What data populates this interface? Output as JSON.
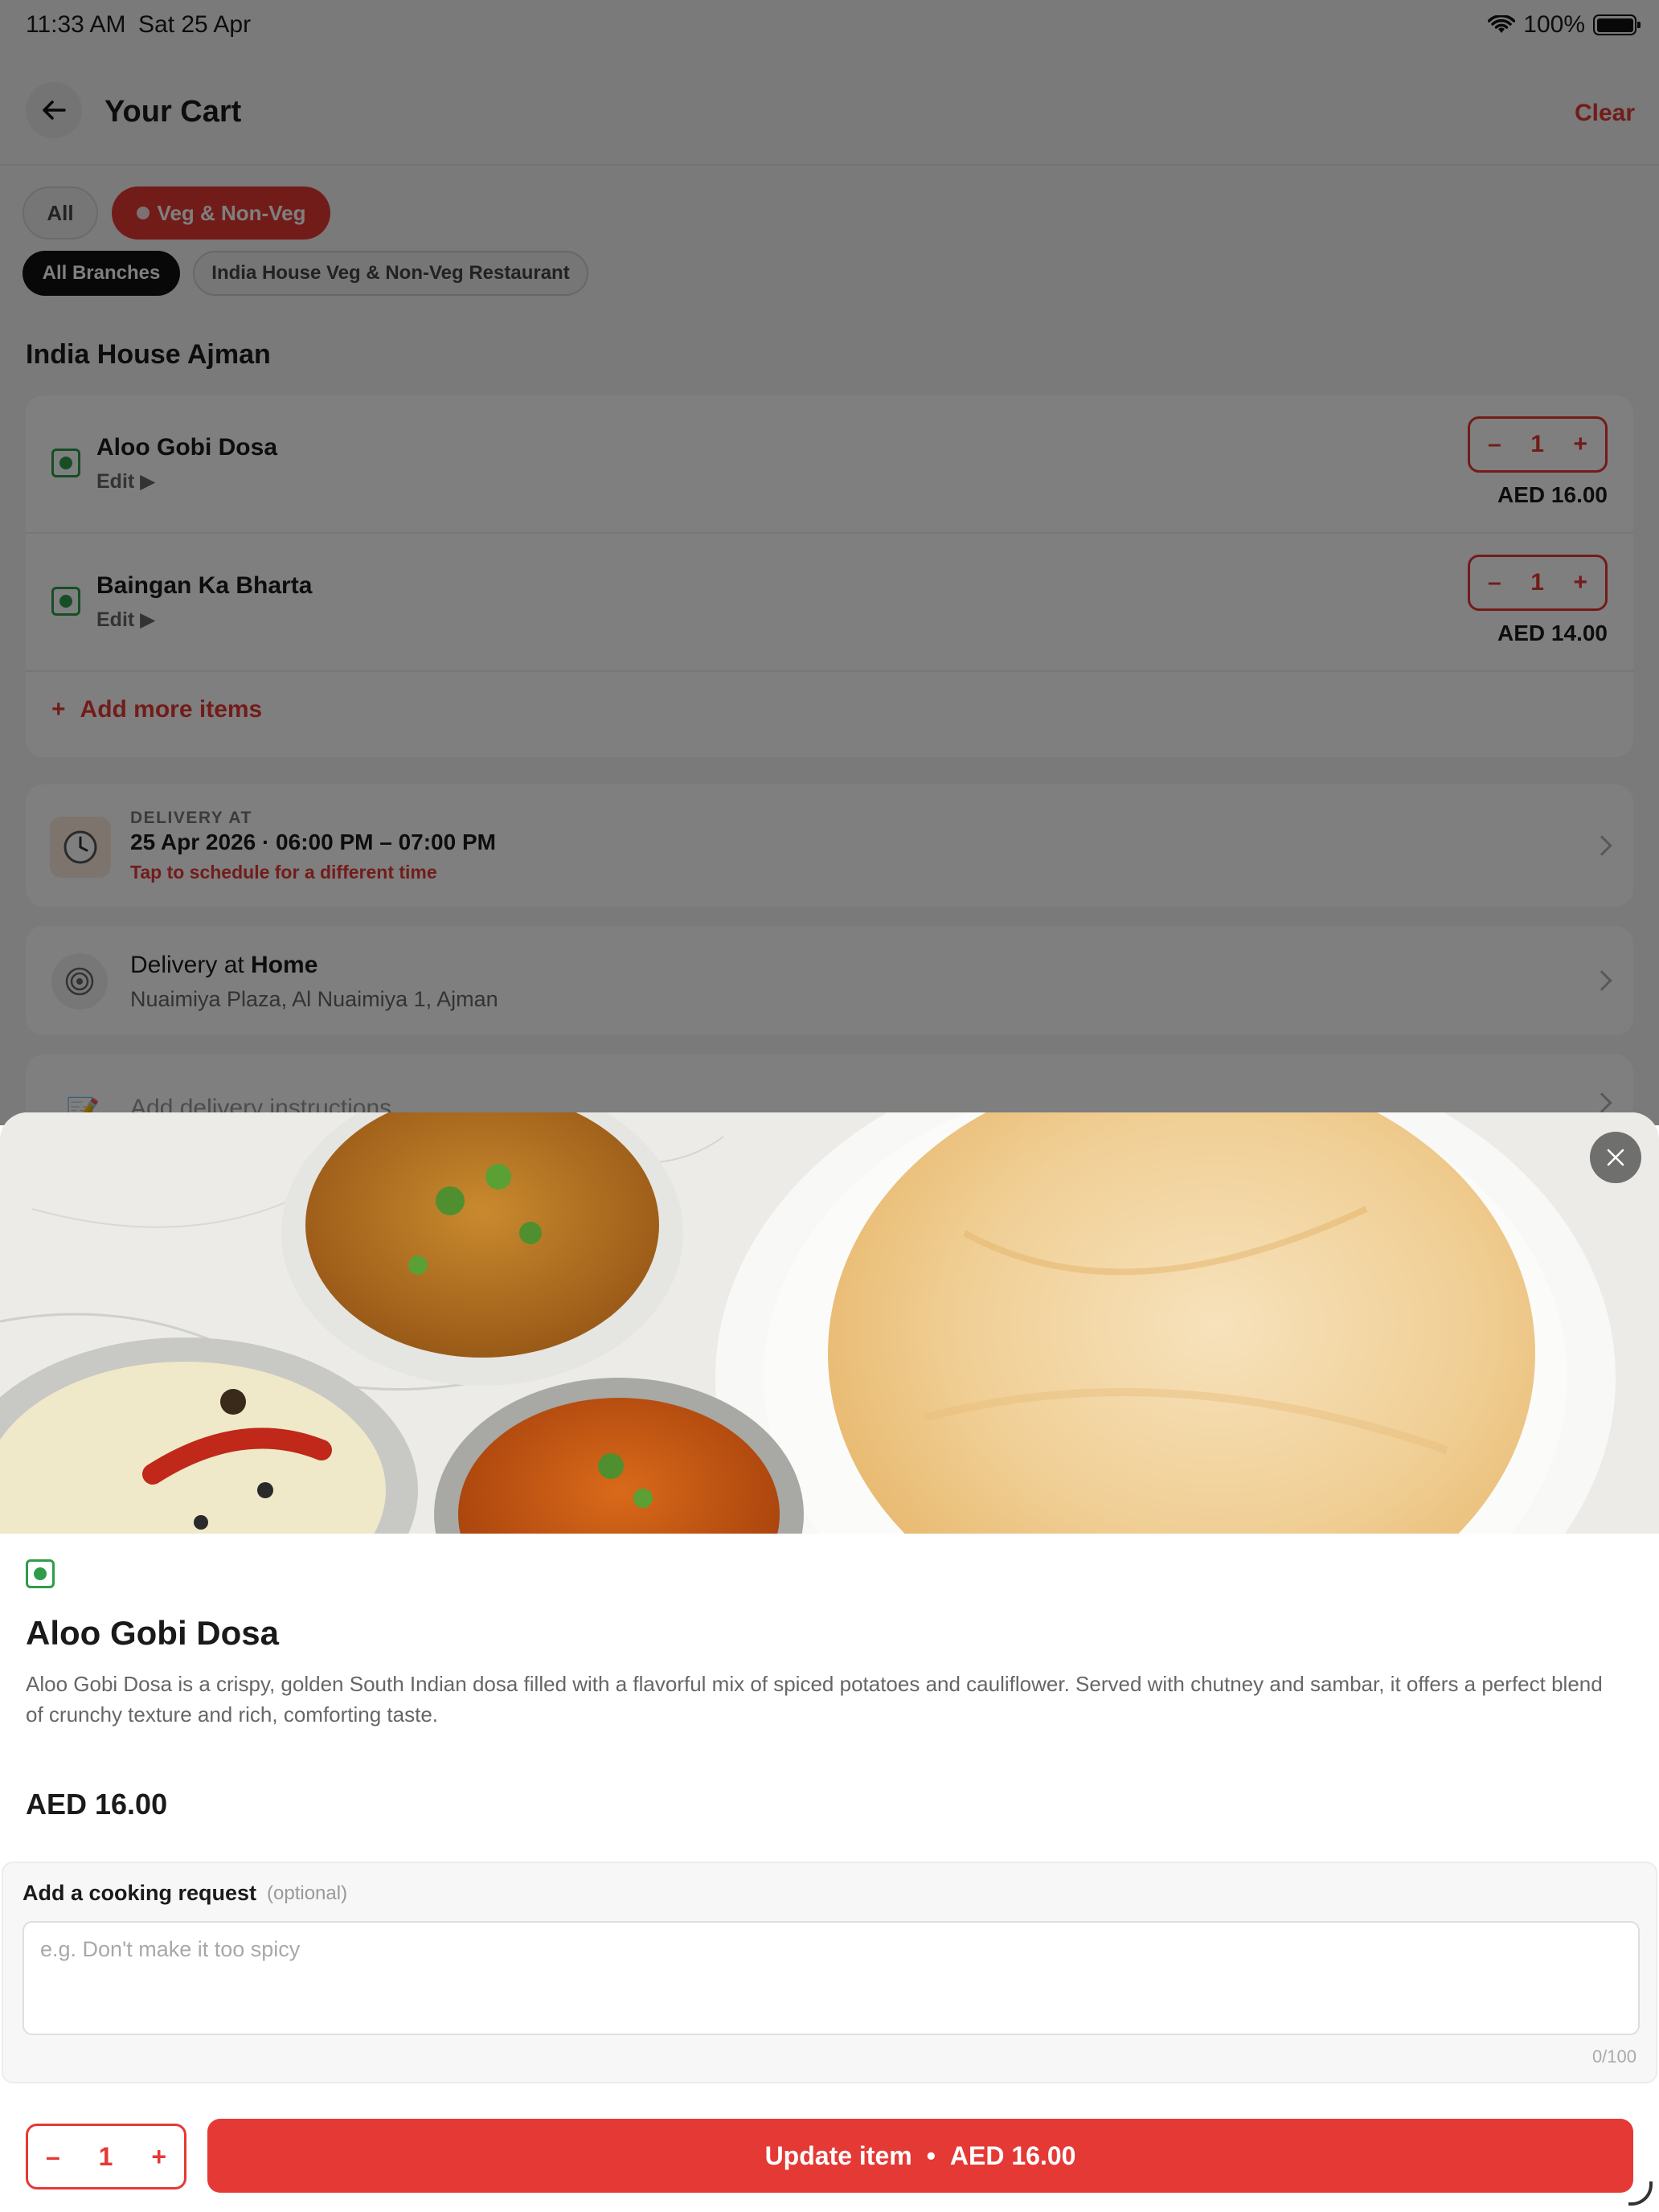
{
  "status_bar": {
    "time": "11:33 AM",
    "date": "Sat 25 Apr",
    "battery": "100%"
  },
  "header": {
    "title": "Your Cart",
    "clear_label": "Clear"
  },
  "filters": {
    "diet": [
      {
        "label": "All"
      },
      {
        "label": "Veg & Non-Veg",
        "selected": true
      }
    ],
    "branches": [
      {
        "label": "All Branches",
        "selected": true
      },
      {
        "label": "India House Veg & Non-Veg Restaurant"
      }
    ]
  },
  "restaurant": {
    "name": "India House Ajman"
  },
  "cart_items": [
    {
      "name": "Aloo Gobi Dosa",
      "edit_label": "Edit ▶",
      "qty": "1",
      "price": "AED 16.00"
    },
    {
      "name": "Baingan Ka Bharta",
      "edit_label": "Edit ▶",
      "qty": "1",
      "price": "AED 14.00"
    }
  ],
  "add_more_label": "Add more items",
  "delivery": {
    "label": "DELIVERY AT",
    "time": "25 Apr 2026  ·  06:00 PM – 07:00 PM",
    "hint": "Tap to schedule for a different time"
  },
  "address": {
    "prefix": "Delivery at ",
    "place": "Home",
    "line2": "Nuaimiya Plaza, Al Nuaimiya 1, Ajman"
  },
  "instructions": {
    "label": "Add delivery instructions"
  },
  "sheet": {
    "dish_name": "Aloo Gobi Dosa",
    "description": "Aloo Gobi Dosa is a crispy, golden South Indian dosa filled with a flavorful mix of spiced potatoes and cauliflower. Served with chutney and sambar, it offers a perfect blend of crunchy texture and rich, comforting taste.",
    "price": "AED 16.00",
    "request_label": "Add a cooking request",
    "request_optional": "(optional)",
    "request_placeholder": "e.g. Don't make it too spicy",
    "request_count": "0/100",
    "qty": "1",
    "update_label": "Update item",
    "update_sep": "•",
    "update_price": "AED 16.00"
  },
  "colors": {
    "accent": "#e53935",
    "veg": "#2e9d4a",
    "overlay": "rgba(0,0,0,0.5)"
  },
  "icons": {
    "back": "arrow-left-icon",
    "clock": "clock-icon",
    "location": "target-icon",
    "instructions": "notepad-icon",
    "close": "close-icon",
    "veg": "veg-indicator-icon",
    "plus": "plus-icon",
    "minus": "minus-icon",
    "chevron": "chevron-right-icon"
  }
}
